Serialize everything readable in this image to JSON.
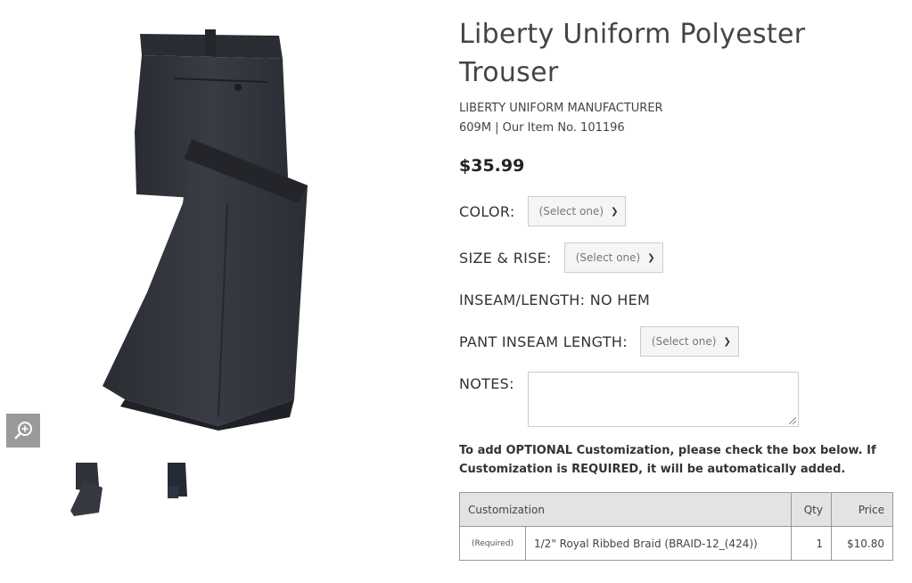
{
  "product": {
    "title": "Liberty Uniform Polyester Trouser",
    "manufacturer": "LIBERTY UNIFORM MANUFACTURER",
    "item_number": "609M | Our Item No. 101196",
    "price": "$35.99"
  },
  "options": {
    "color": {
      "label": "COLOR:",
      "value": "(Select one)"
    },
    "size_rise": {
      "label": "SIZE & RISE:",
      "value": "(Select one)"
    },
    "inseam_length": {
      "label": "INSEAM/LENGTH: NO HEM"
    },
    "pant_inseam": {
      "label": "PANT INSEAM LENGTH:",
      "value": "(Select one)"
    },
    "notes": {
      "label": "NOTES:",
      "value": ""
    }
  },
  "customization": {
    "note": "To add OPTIONAL Customization, please check the box below. If Customization is REQUIRED, it will be automatically added.",
    "headers": {
      "name": "Customization",
      "qty": "Qty",
      "price": "Price"
    },
    "rows": [
      {
        "status": "(Required)",
        "name": "1/2\" Royal Ribbed Braid (BRAID-12_(424))",
        "qty": "1",
        "price": "$10.80"
      }
    ]
  },
  "colors": {
    "trouser": "#33353d",
    "zoom_button": "#9a9a9a",
    "table_header": "#e3e3e3"
  },
  "icons": {
    "zoom": "zoom-in-icon",
    "select": "chevron-down-icon"
  }
}
